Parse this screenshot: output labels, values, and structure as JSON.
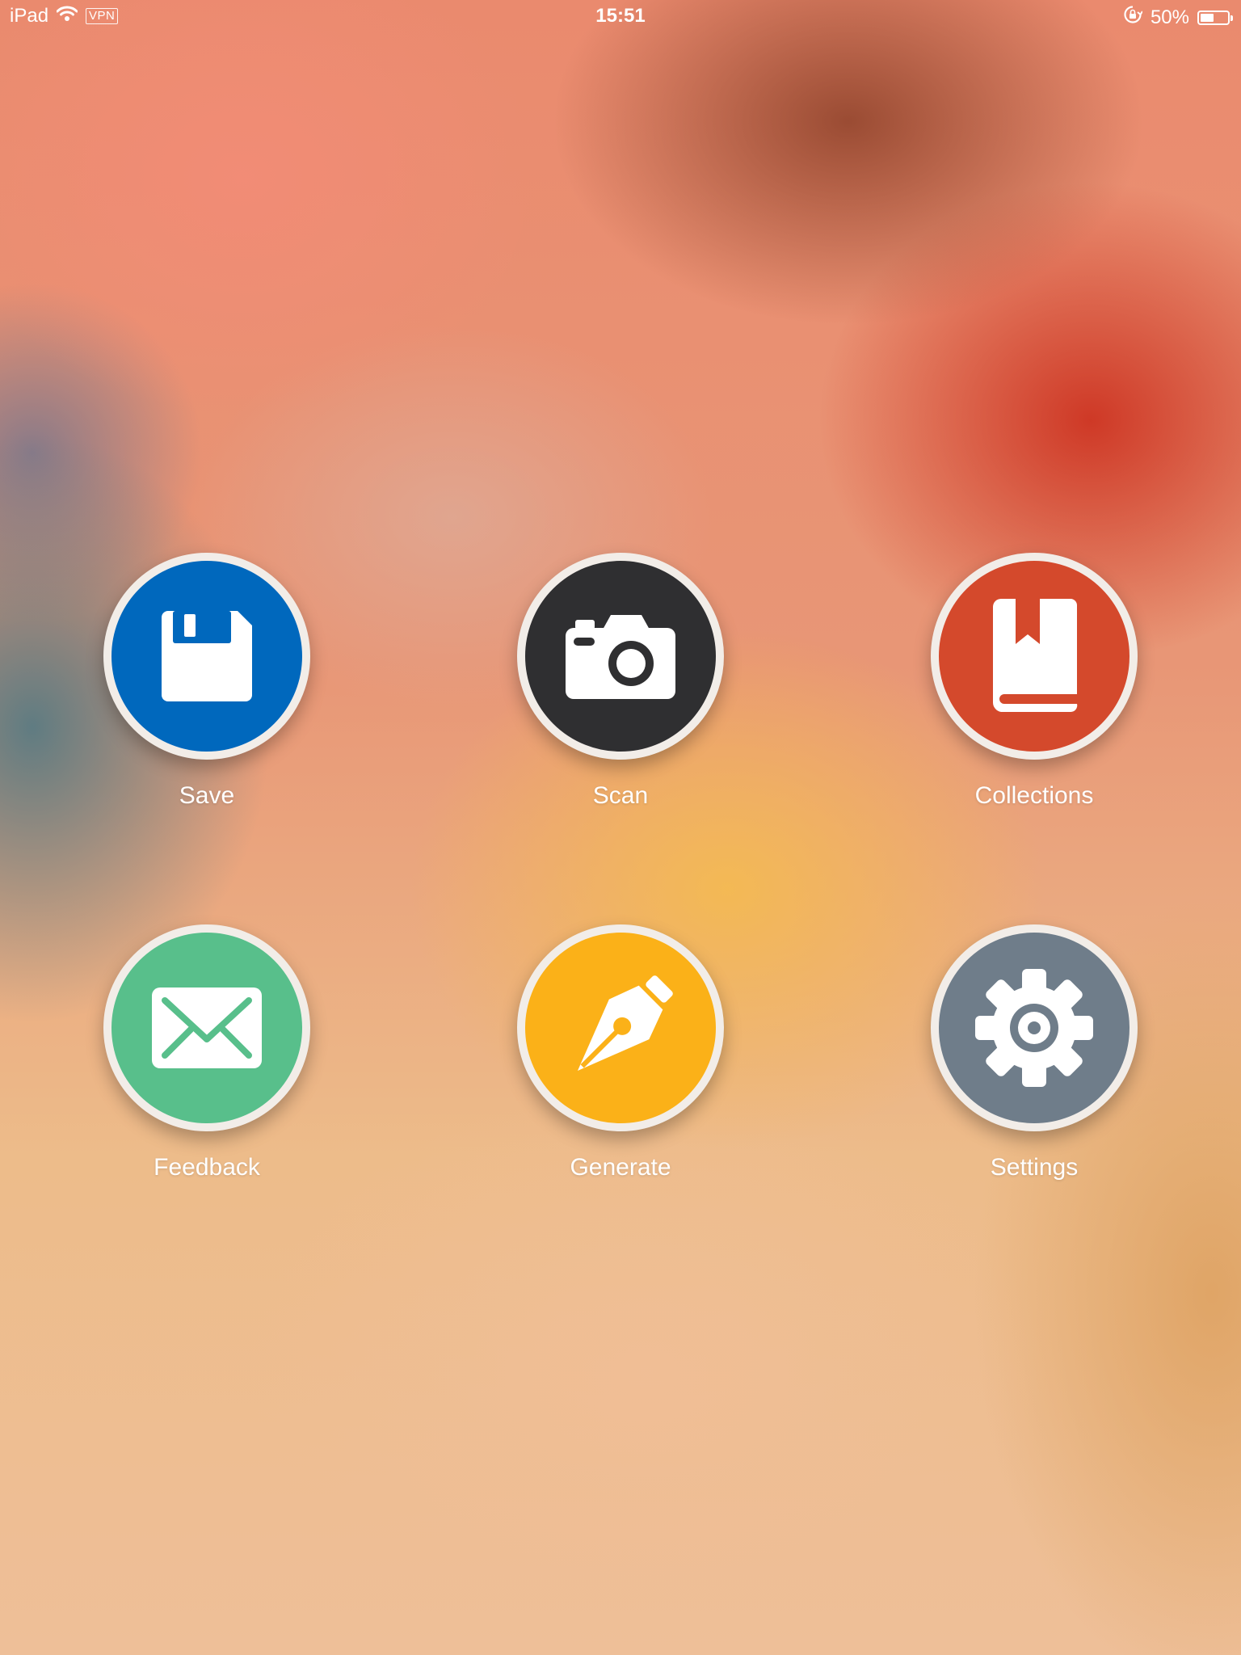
{
  "status_bar": {
    "device": "iPad",
    "vpn": "VPN",
    "time": "15:51",
    "battery_text": "50%",
    "battery_level": 0.5,
    "icons": [
      "wifi-icon",
      "rotation-lock-icon",
      "battery-icon"
    ]
  },
  "menu": {
    "items": [
      {
        "label": "Save",
        "icon": "floppy-disk-icon",
        "color": "#0068bd"
      },
      {
        "label": "Scan",
        "icon": "camera-icon",
        "color": "#2f2f31"
      },
      {
        "label": "Collections",
        "icon": "bookmark-book-icon",
        "color": "#d4492c"
      },
      {
        "label": "Feedback",
        "icon": "envelope-icon",
        "color": "#58bf8b"
      },
      {
        "label": "Generate",
        "icon": "pen-nib-icon",
        "color": "#fbb118"
      },
      {
        "label": "Settings",
        "icon": "gear-icon",
        "color": "#6f7d8a"
      }
    ]
  }
}
